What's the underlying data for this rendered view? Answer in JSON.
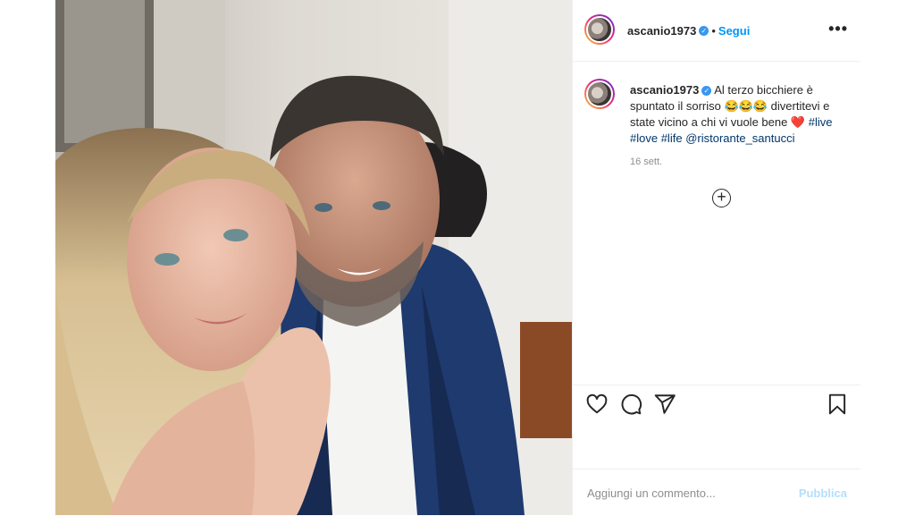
{
  "post": {
    "username": "ascanio1973",
    "follow_label": "Segui",
    "separator": "•",
    "more_label": "•••",
    "caption": {
      "text": "Al terzo bicchiere è spuntato il sorriso 😂😂😂 divertitevi e state vicino a chi vi vuole bene ❤️",
      "tags": [
        "#live",
        "#love",
        "#life",
        "@ristorante_santucci"
      ]
    },
    "timestamp": "16 sett.",
    "load_more_icon": "plus-circle-icon"
  },
  "actions": {
    "icons": [
      "heart-icon",
      "comment-icon",
      "share-icon",
      "bookmark-icon"
    ]
  },
  "comment_box": {
    "placeholder": "Aggiungi un commento...",
    "publish_label": "Pubblica"
  },
  "colors": {
    "link": "#0095f6",
    "publish_disabled": "#b2dffc",
    "hashtag": "#00376b",
    "muted": "#8e8e8e"
  }
}
